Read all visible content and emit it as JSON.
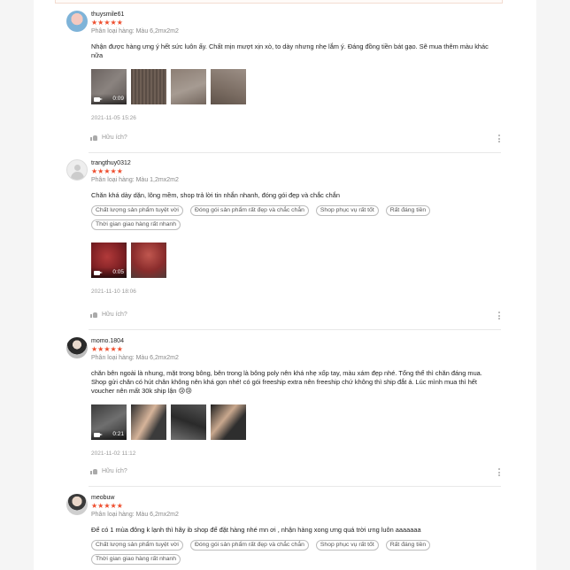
{
  "reviews": [
    {
      "username": "thuysmile61",
      "stars": "★★★★★",
      "variant": "Phân loại hàng: Màu 6,2mx2m2",
      "comment": "Nhận được hàng ưng ý hết sức luôn ấy. Chất mịn mượt xịn xò, to dày nhưng nhẹ lắm ý. Đáng đồng tiền bát gạo. Sẽ mua thêm màu khác nữa",
      "tags": [],
      "video_duration": "0:09",
      "date": "2021-11-05 15:26",
      "helpful": "Hữu ích?"
    },
    {
      "username": "trangthuy0312",
      "stars": "★★★★★",
      "variant": "Phân loại hàng: Màu 1,2mx2m2",
      "comment": "Chăn khá dày dặn, lông mềm, shop trả lời tin nhắn nhanh, đóng gói đẹp và chắc chắn",
      "tags": [
        "Chất lượng sản phẩm tuyệt vời",
        "Đóng gói sản phẩm rất đẹp và chắc chắn",
        "Shop phục vụ rất tốt",
        "Rất đáng tiền",
        "Thời gian giao hàng rất nhanh"
      ],
      "video_duration": "0:05",
      "date": "2021-11-10 18:06",
      "helpful": "Hữu ích?"
    },
    {
      "username": "momo.1804",
      "stars": "★★★★★",
      "variant": "Phân loại hàng: Màu 6,2mx2m2",
      "comment": "chăn bên ngoài là nhung, mặt trong bông, bên trong là bông poly nên khá nhẹ xốp tay, màu xám đẹp nhé. Tổng thể thì chăn đáng mua. Shop gửi chăn có hút chân không nên khá gọn nhé! có gói freeship extra nên freeship chứ không thì ship đắt á. Lúc mình mua thì hết voucher nên mất 30k ship lận 😢😢",
      "tags": [],
      "video_duration": "0:21",
      "date": "2021-11-02 11:12",
      "helpful": "Hữu ích?"
    },
    {
      "username": "meobuw",
      "stars": "★★★★★",
      "variant": "Phân loại hàng: Màu 6,2mx2m2",
      "comment": "Để có 1 mùa đông k lạnh thì hãy ib shop để đặt hàng nhé mn ơi , nhận hàng xong ưng quá trời ưng luôn aaaaaaa",
      "tags": [
        "Chất lượng sản phẩm tuyệt vời",
        "Đóng gói sản phẩm rất đẹp và chắc chắn",
        "Shop phục vụ rất tốt",
        "Rất đáng tiền",
        "Thời gian giao hàng rất nhanh"
      ]
    }
  ],
  "colors": {
    "star": "#ee4d2d",
    "muted": "#999999",
    "background": "#f5f5f5"
  }
}
